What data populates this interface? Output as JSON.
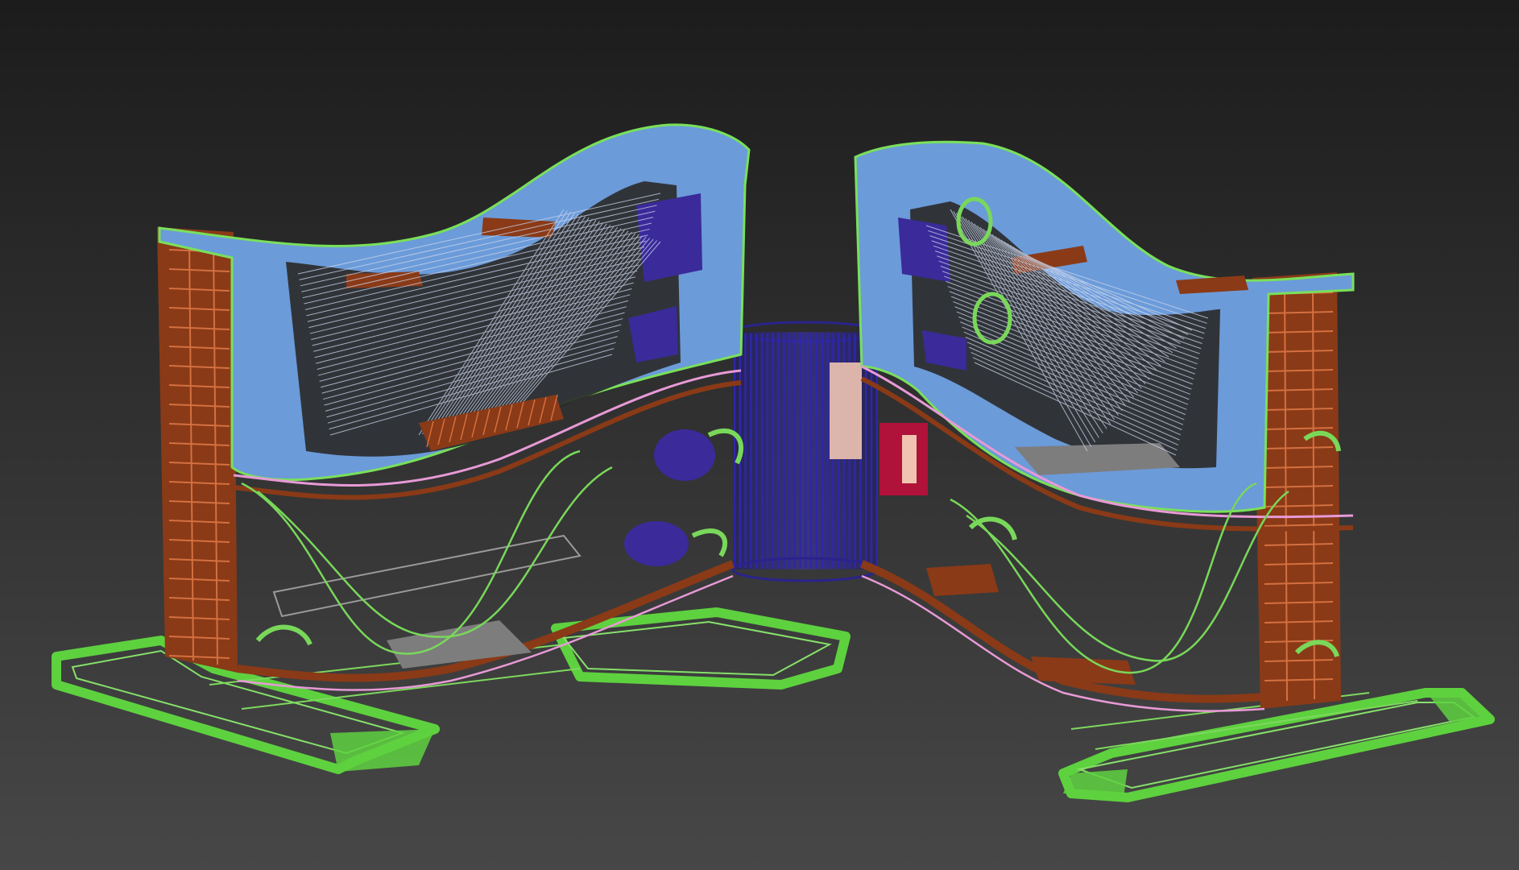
{
  "viewport": {
    "mode": "perspective-wireframe-shaded",
    "background": {
      "top": "#1c1c1c",
      "bottom": "#474747"
    }
  },
  "colors": {
    "shell_blue": "#6b9bd9",
    "frame_rust": "#8a3a17",
    "wire_green": "#6fd24a",
    "base_green": "#5ed13f",
    "wire_pink": "#e79ad6",
    "cylinder_navy": "#2a238c",
    "seat_purple": "#3b2a9a",
    "cable_white": "#cfd8ee",
    "panel_gray": "#7d7d7d",
    "panel_pink": "#f0c4b0",
    "accent_red": "#b0123a"
  },
  "scene": {
    "objects": [
      {
        "name": "left-wing-structure"
      },
      {
        "name": "right-wing-structure"
      },
      {
        "name": "central-cylinder"
      },
      {
        "name": "left-base-frame"
      },
      {
        "name": "right-base-frame"
      }
    ]
  }
}
